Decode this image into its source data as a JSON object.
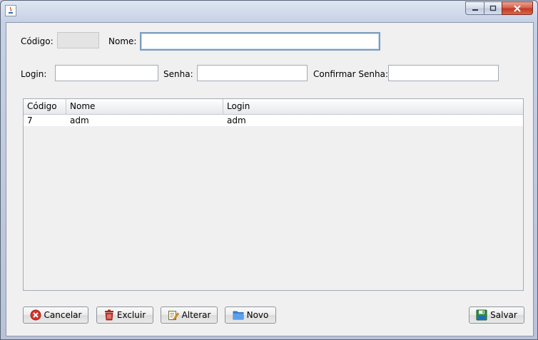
{
  "window": {
    "controls": {
      "minimize": "minimize-icon",
      "maximize": "maximize-icon",
      "close": "close-icon"
    }
  },
  "form": {
    "codigo_label": "Código:",
    "codigo_value": "",
    "nome_label": "Nome:",
    "nome_value": "",
    "login_label": "Login:",
    "login_value": "",
    "senha_label": "Senha:",
    "senha_value": "",
    "confirmar_label": "Confirmar Senha:",
    "confirmar_value": ""
  },
  "table": {
    "columns": [
      "Código",
      "Nome",
      "Login"
    ],
    "rows": [
      [
        "7",
        "adm",
        "adm"
      ]
    ]
  },
  "buttons": {
    "cancelar": "Cancelar",
    "excluir": "Excluir",
    "alterar": "Alterar",
    "novo": "Novo",
    "salvar": "Salvar"
  },
  "icons": {
    "cancelar": "cancel-icon",
    "excluir": "trash-icon",
    "alterar": "edit-icon",
    "novo": "folder-icon",
    "salvar": "save-icon"
  }
}
